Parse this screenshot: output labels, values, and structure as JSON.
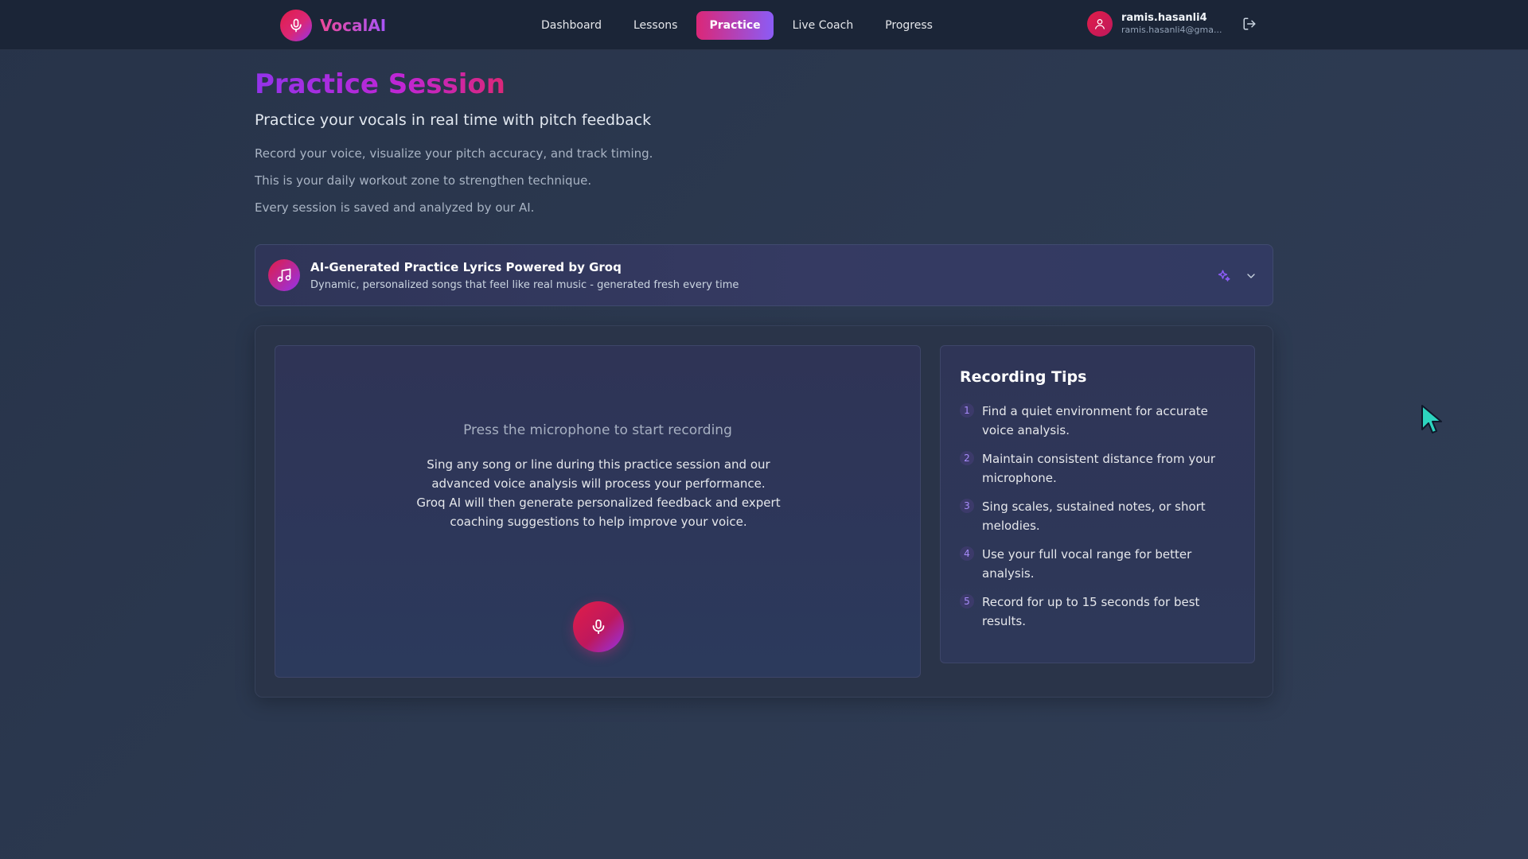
{
  "nav": {
    "brand": "VocalAI",
    "links": [
      {
        "label": "Dashboard",
        "active": false
      },
      {
        "label": "Lessons",
        "active": false
      },
      {
        "label": "Practice",
        "active": true
      },
      {
        "label": "Live Coach",
        "active": false
      },
      {
        "label": "Progress",
        "active": false
      }
    ],
    "user": {
      "name": "ramis.hasanli4",
      "email": "ramis.hasanli4@gma..."
    }
  },
  "header": {
    "title": "Practice Session",
    "subtitle": "Practice your vocals in real time with pitch feedback",
    "descriptions": [
      "Record your voice, visualize your pitch accuracy, and track timing.",
      "This is your daily workout zone to strengthen technique.",
      "Every session is saved and analyzed by our AI."
    ]
  },
  "lyrics_banner": {
    "title": "AI-Generated Practice Lyrics Powered by Groq",
    "subtitle": "Dynamic, personalized songs that feel like real music - generated fresh every time"
  },
  "recording": {
    "prompt": "Press the microphone to start recording",
    "description": "Sing any song or line during this practice session and our advanced voice analysis will process your performance. Groq AI will then generate personalized feedback and expert coaching suggestions to help improve your voice."
  },
  "tips": {
    "title": "Recording Tips",
    "items": [
      {
        "num": "1",
        "text": "Find a quiet environment for accurate voice analysis."
      },
      {
        "num": "2",
        "text": "Maintain consistent distance from your microphone."
      },
      {
        "num": "3",
        "text": "Sing scales, sustained notes, or short melodies."
      },
      {
        "num": "4",
        "text": "Use your full vocal range for better analysis."
      },
      {
        "num": "5",
        "text": "Record for up to 15 seconds for best results."
      }
    ]
  },
  "icons": {
    "brand_logo": "microphone-icon",
    "user_avatar": "user-icon",
    "logout": "logout-icon",
    "lyrics": "music-note-icon",
    "sparkle": "sparkles-icon",
    "expand": "chevron-down-icon",
    "record": "microphone-icon"
  },
  "colors": {
    "accent_pink": "#db2777",
    "accent_purple": "#9333ea",
    "nav_bg": "#1b2537",
    "page_bg": "#2c3950",
    "cursor": "#2dd4bf"
  }
}
